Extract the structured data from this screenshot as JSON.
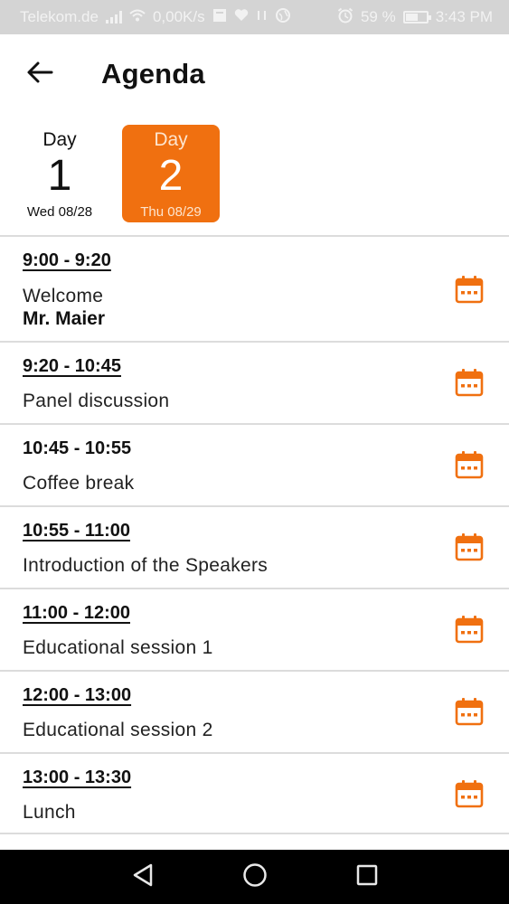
{
  "status_bar": {
    "carrier": "Telekom.de",
    "network_speed": "0,00K/s",
    "battery": "59 %",
    "battery_level": 0.59,
    "time": "3:43 PM"
  },
  "header": {
    "title": "Agenda"
  },
  "day_tabs": [
    {
      "label": "Day",
      "number": "1",
      "date": "Wed 08/28",
      "selected": false
    },
    {
      "label": "Day",
      "number": "2",
      "date": "Thu 08/29",
      "selected": true
    }
  ],
  "accent_color": "#F07010",
  "agenda": [
    {
      "time": "9:00 - 9:20",
      "title": "Welcome",
      "speaker": "Mr. Maier"
    },
    {
      "time": "9:20 - 10:45",
      "title": "Panel discussion"
    },
    {
      "time": "10:45 - 10:55",
      "title": "Coffee break"
    },
    {
      "time": "10:55 - 11:00",
      "title": "Introduction of the Speakers"
    },
    {
      "time": "11:00 - 12:00",
      "title": "Educational session 1"
    },
    {
      "time": "12:00 - 13:00",
      "title": "Educational session 2"
    },
    {
      "time": "13:00 - 13:30",
      "title": "Lunch"
    }
  ],
  "icons": {
    "back": "arrow-left-icon",
    "calendar": "calendar-icon",
    "nav_back": "triangle-back-icon",
    "nav_home": "circle-home-icon",
    "nav_recents": "square-recents-icon"
  }
}
